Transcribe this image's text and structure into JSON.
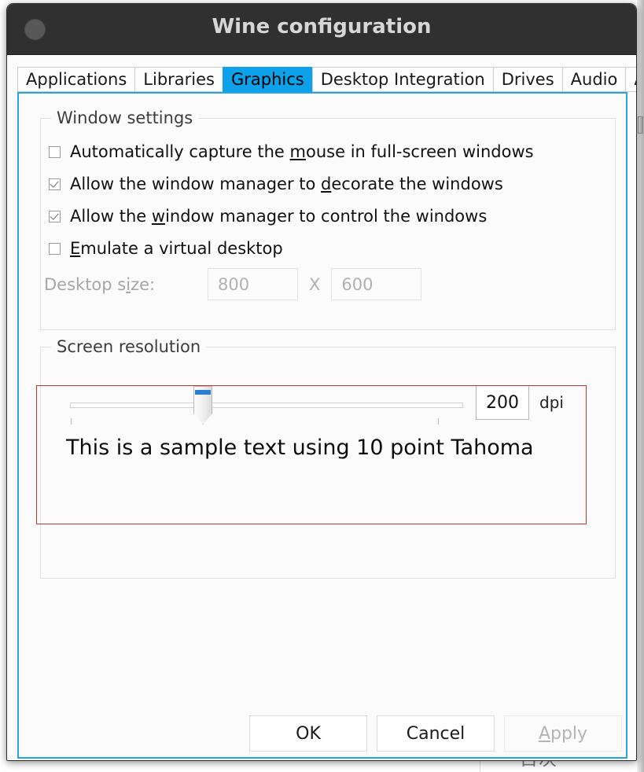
{
  "window": {
    "title": "Wine configuration",
    "menu_button_icon": "window-menu-icon"
  },
  "tabs": [
    {
      "label": "Applications",
      "selected": false
    },
    {
      "label": "Libraries",
      "selected": false
    },
    {
      "label": "Graphics",
      "selected": true
    },
    {
      "label": "Desktop Integration",
      "selected": false
    },
    {
      "label": "Drives",
      "selected": false
    },
    {
      "label": "Audio",
      "selected": false
    },
    {
      "label": "About",
      "selected": false
    }
  ],
  "graphics": {
    "window_settings": {
      "title": "Window settings",
      "checkboxes": [
        {
          "pre": "Automatically capture the ",
          "mnemonic": "m",
          "post": "ouse in full-screen windows",
          "checked": false
        },
        {
          "pre": "Allow the window manager to ",
          "mnemonic": "d",
          "post": "ecorate the windows",
          "checked": true
        },
        {
          "pre": "Allow the ",
          "mnemonic": "w",
          "post": "indow manager to control the windows",
          "checked": true
        },
        {
          "pre": "",
          "mnemonic": "E",
          "post": "mulate a virtual desktop",
          "checked": false
        }
      ],
      "desktop_size": {
        "label_pre": "Desktop s",
        "label_mnemonic": "i",
        "label_post": "ze:",
        "width_value": "800",
        "separator": "X",
        "height_value": "600",
        "enabled": false
      }
    },
    "screen_resolution": {
      "title": "Screen resolution",
      "dpi_value": "200",
      "dpi_unit": "dpi",
      "slider_percent": 33,
      "sample_text": "This is a sample text using 10 point Tahoma",
      "highlight_color": "#c0392b"
    }
  },
  "buttons": [
    {
      "label": "OK",
      "mnemonic": "",
      "disabled": false
    },
    {
      "label": "Cancel",
      "mnemonic": "",
      "disabled": false
    },
    {
      "label": "Apply",
      "mnemonic": "A",
      "disabled": true
    }
  ],
  "background": {
    "window_text": "目次"
  },
  "colors": {
    "accent_blue": "#0ca1e8",
    "focus_border": "#29a4e0",
    "titlebar": "#303030",
    "slider_accent": "#2c7fd0",
    "highlight_red": "#c0392b"
  }
}
